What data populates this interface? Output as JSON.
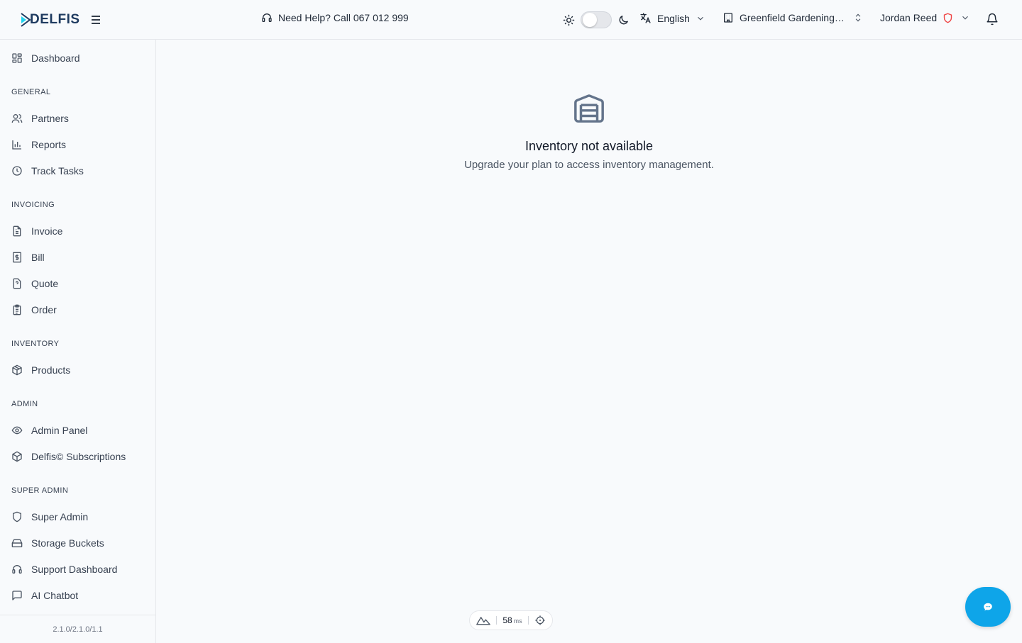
{
  "app": {
    "brand": "DELFIS"
  },
  "header": {
    "help_text": "Need Help? Call 067 012 999",
    "language": "English",
    "organization": "Greenfield Gardening Co.",
    "user_name": "Jordan Reed"
  },
  "sidebar": {
    "dashboard": "Dashboard",
    "sections": {
      "general": "GENERAL",
      "invoicing": "INVOICING",
      "inventory": "INVENTORY",
      "admin": "ADMIN",
      "super_admin": "SUPER ADMIN"
    },
    "general": [
      "Partners",
      "Reports",
      "Track Tasks"
    ],
    "invoicing": [
      "Invoice",
      "Bill",
      "Quote",
      "Order"
    ],
    "inventory": [
      "Products"
    ],
    "admin": [
      "Admin Panel",
      "Delfis© Subscriptions"
    ],
    "super_admin": [
      "Super Admin",
      "Storage Buckets",
      "Support Dashboard",
      "AI Chatbot"
    ],
    "version": "2.1.0/2.1.0/1.1"
  },
  "main": {
    "empty_title": "Inventory not available",
    "empty_subtitle": "Upgrade your plan to access inventory management."
  },
  "perf": {
    "value": "58",
    "unit": "ms"
  },
  "colors": {
    "accent": "#0ea5e9",
    "danger": "#ef4444",
    "icon": "#4b5563"
  }
}
